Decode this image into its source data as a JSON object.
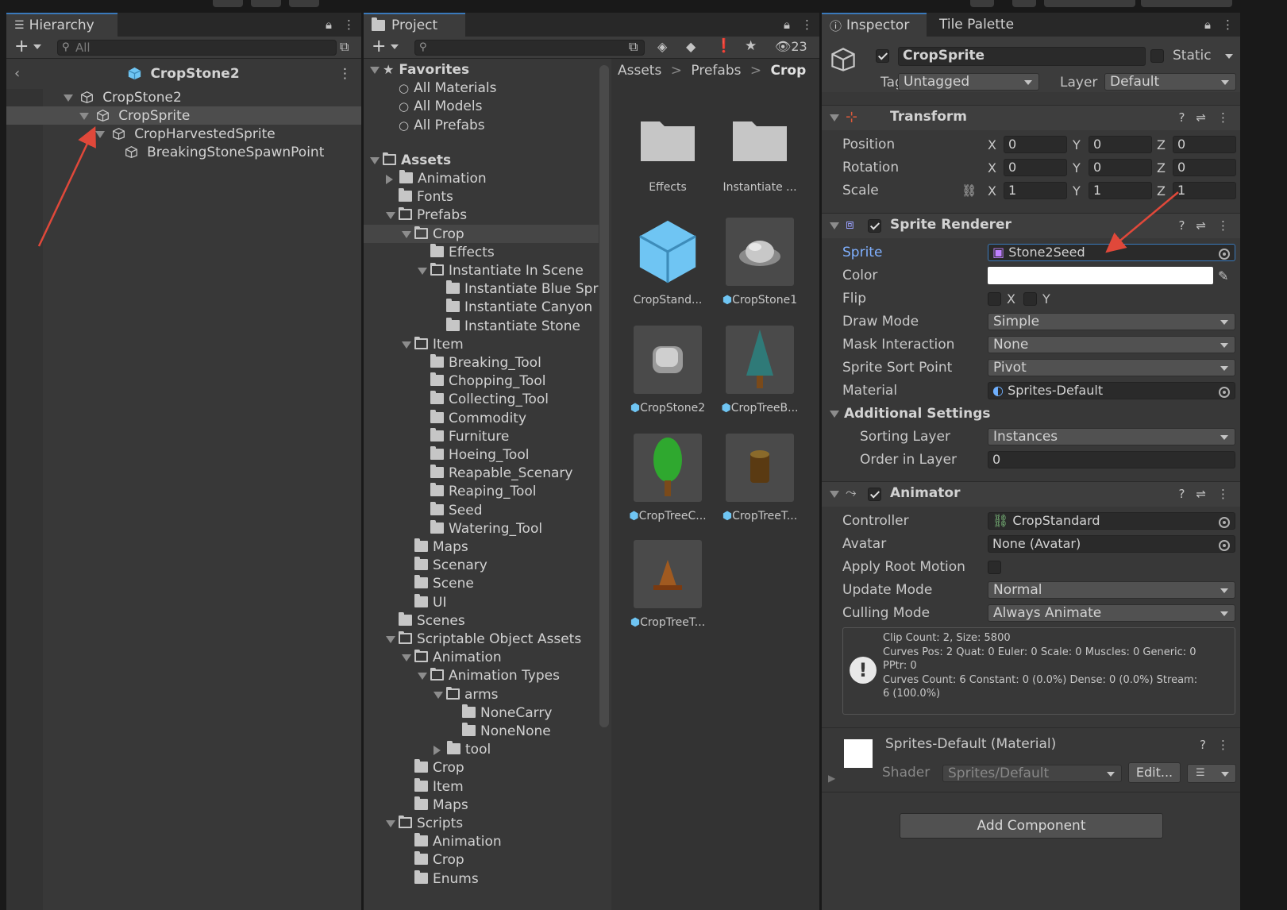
{
  "colors": {
    "accent": "#3a79bb",
    "annotation_arrow": "#e0483a",
    "prefab_blue": "#6fc5f3"
  },
  "hierarchy": {
    "tab_label": "Hierarchy",
    "search_placeholder": "All",
    "scene_title": "CropStone2",
    "rows": [
      {
        "label": "CropStone2"
      },
      {
        "label": "CropSprite"
      },
      {
        "label": "CropHarvestedSprite"
      },
      {
        "label": "BreakingStoneSpawnPoint"
      }
    ]
  },
  "project": {
    "tab_label": "Project",
    "hidden_count": "23",
    "favorites_label": "Favorites",
    "favorites": [
      "All Materials",
      "All Models",
      "All Prefabs"
    ],
    "assets_label": "Assets",
    "tree": [
      "Animation",
      "Fonts",
      "Prefabs",
      "Crop",
      "Effects",
      "Instantiate In Scene",
      "Instantiate Blue Spr",
      "Instantiate Canyon",
      "Instantiate Stone",
      "Item",
      "Breaking_Tool",
      "Chopping_Tool",
      "Collecting_Tool",
      "Commodity",
      "Furniture",
      "Hoeing_Tool",
      "Reapable_Scenary",
      "Reaping_Tool",
      "Seed",
      "Watering_Tool",
      "Maps",
      "Scenary",
      "Scene",
      "UI",
      "Scenes",
      "Scriptable Object Assets",
      "Animation",
      "Animation Types",
      "arms",
      "NoneCarry",
      "NoneNone",
      "tool",
      "Crop",
      "Item",
      "Maps",
      "Scripts",
      "Animation",
      "Crop",
      "Enums"
    ],
    "breadcrumb": [
      "Assets",
      "Prefabs",
      "Crop"
    ],
    "grid": [
      "Effects",
      "Instantiate ...",
      "CropStand...",
      "CropStone1",
      "CropStone2",
      "CropTreeB...",
      "CropTreeC...",
      "CropTreeT...",
      "CropTreeT..."
    ]
  },
  "inspector": {
    "tab_label": "Inspector",
    "tab2_label": "Tile Palette",
    "object_name": "CropSprite",
    "static_label": "Static",
    "tag_label": "Tag",
    "tag_value": "Untagged",
    "layer_label": "Layer",
    "layer_value": "Default",
    "transform": {
      "title": "Transform",
      "position_label": "Position",
      "rotation_label": "Rotation",
      "scale_label": "Scale",
      "position": [
        "0",
        "0",
        "0"
      ],
      "rotation": [
        "0",
        "0",
        "0"
      ],
      "scale": [
        "1",
        "1",
        "1"
      ],
      "axes": [
        "X",
        "Y",
        "Z"
      ]
    },
    "sprite_renderer": {
      "title": "Sprite Renderer",
      "sprite_label": "Sprite",
      "sprite_value": "Stone2Seed",
      "color_label": "Color",
      "color_value": "#ffffff",
      "flip_label": "Flip",
      "flip_x": "X",
      "flip_y": "Y",
      "draw_mode_label": "Draw Mode",
      "draw_mode": "Simple",
      "mask_label": "Mask Interaction",
      "mask": "None",
      "sort_point_label": "Sprite Sort Point",
      "sort_point": "Pivot",
      "material_label": "Material",
      "material": "Sprites-Default",
      "additional_label": "Additional Settings",
      "sorting_layer_label": "Sorting Layer",
      "sorting_layer": "Instances",
      "order_label": "Order in Layer",
      "order": "0"
    },
    "animator": {
      "title": "Animator",
      "controller_label": "Controller",
      "controller": "CropStandard",
      "avatar_label": "Avatar",
      "avatar": "None (Avatar)",
      "root_motion_label": "Apply Root Motion",
      "update_label": "Update Mode",
      "update": "Normal",
      "culling_label": "Culling Mode",
      "culling": "Always Animate",
      "info": [
        "Clip Count: 2, Size: 5800",
        "Curves Pos: 2 Quat: 0 Euler: 0 Scale: 0 Muscles: 0 Generic: 0",
        "PPtr: 0",
        "Curves Count: 6 Constant: 0 (0.0%) Dense: 0 (0.0%) Stream:",
        "6 (100.0%)"
      ]
    },
    "material_block": {
      "title": "Sprites-Default (Material)",
      "shader_label": "Shader",
      "shader": "Sprites/Default",
      "edit_label": "Edit..."
    },
    "add_component": "Add Component"
  }
}
